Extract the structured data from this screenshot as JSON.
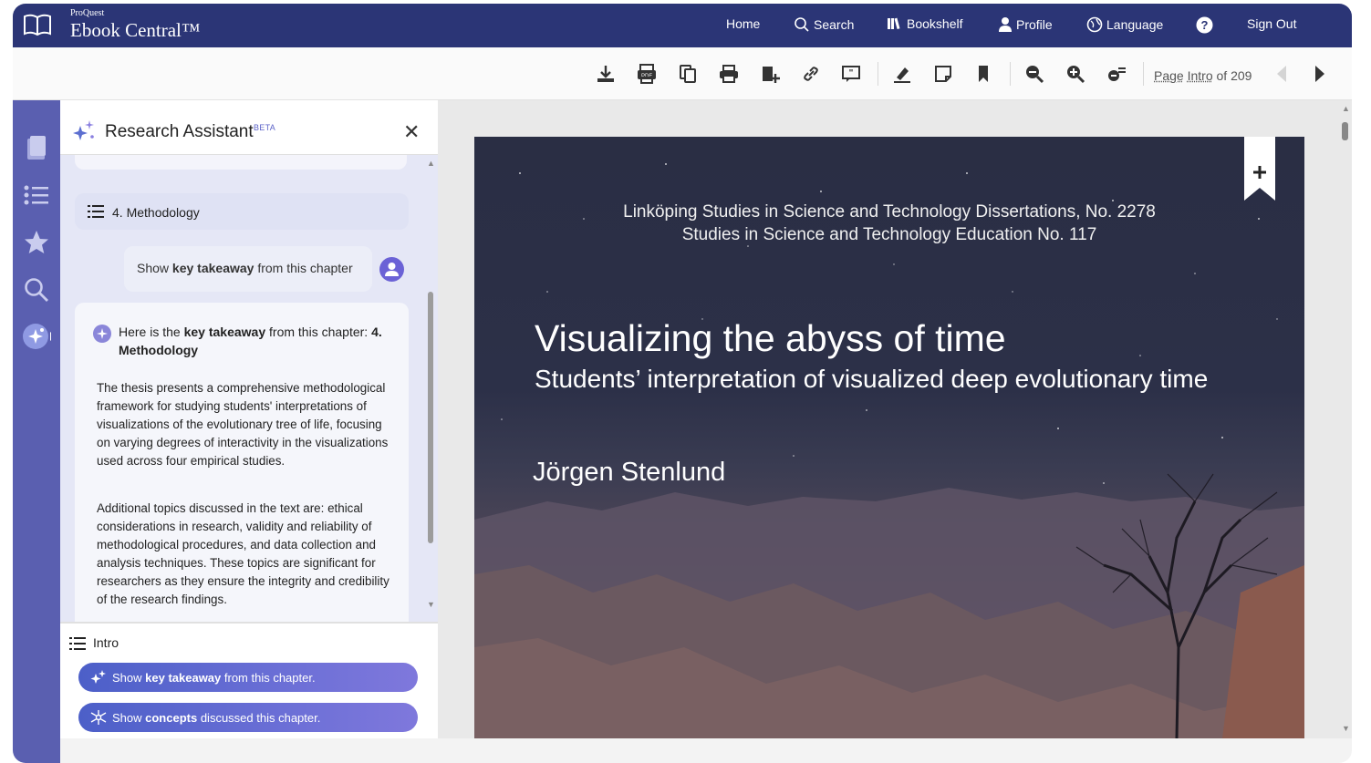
{
  "brand": {
    "small": "ProQuest",
    "big": "Ebook Central™"
  },
  "nav": {
    "home": "Home",
    "search": "Search",
    "bookshelf": "Bookshelf",
    "profile": "Profile",
    "language": "Language",
    "signout": "Sign Out"
  },
  "toolbar": {
    "icons": [
      "download-icon",
      "pdf-icon",
      "copy-icon",
      "print-icon",
      "add-to-bookshelf-icon",
      "link-icon",
      "cite-icon",
      "highlight-icon",
      "note-icon",
      "bookmark-icon",
      "zoom-out-icon",
      "zoom-in-icon",
      "fit-page-icon"
    ],
    "page_label": "Page",
    "page_value": "Intro",
    "page_of": "of 209"
  },
  "rail": {
    "icons": [
      "contents-icon",
      "list-icon",
      "favorites-star-icon",
      "search-icon",
      "research-assistant-icon"
    ]
  },
  "assistant": {
    "title": "Research Assistant",
    "beta": "BETA",
    "close": "✕",
    "chapter_row": "4. Methodology",
    "user_msg": {
      "pre": "Show ",
      "bold": "key takeaway",
      "post": " from this chapter"
    },
    "answer_head": {
      "pre": "Here is the ",
      "bold1": "key takeaway",
      "mid": " from this chapter: ",
      "bold2": "4. Methodology"
    },
    "answer_p1": "The thesis presents a comprehensive methodological framework for studying students' interpretations of visualizations of the evolutionary tree of life, focusing on varying degrees of interactivity in the visualizations used across four empirical studies.",
    "answer_p2": "Additional topics discussed in the text are: ethical considerations in research, validity and reliability of methodological procedures, and data collection and analysis techniques. These topics are significant for researchers as they ensure the integrity and credibility of the research findings.",
    "footer_label": "Intro",
    "pill1": {
      "pre": "Show ",
      "bold": "key takeaway",
      "post": " from this chapter."
    },
    "pill2": {
      "pre": "Show ",
      "bold": "concepts",
      "post": " discussed this chapter."
    }
  },
  "cover": {
    "series1": "Linköping Studies in Science and Technology Dissertations, No. 2278",
    "series2": "Studies in Science and Technology Education No. 117",
    "title": "Visualizing the abyss of time",
    "subtitle": "Students’ interpretation of visualized deep evolutionary time",
    "author": "Jörgen Stenlund"
  },
  "colors": {
    "nav_bg": "#2b3576",
    "rail_bg": "#5a5fb0",
    "accent": "#6b6fd6"
  }
}
